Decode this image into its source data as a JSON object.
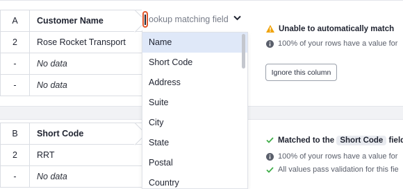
{
  "columns": [
    {
      "letter": "A",
      "name": "Customer Name",
      "rows": [
        {
          "num": "2",
          "value": "Rose Rocket Transport",
          "empty": false
        },
        {
          "num": "-",
          "value": "No data",
          "empty": true
        },
        {
          "num": "-",
          "value": "No data",
          "empty": true
        }
      ],
      "status": {
        "title": "Unable to automatically match",
        "info": "100% of your rows have a value for",
        "ignore_button": "Ignore this column"
      }
    },
    {
      "letter": "B",
      "name": "Short Code",
      "rows": [
        {
          "num": "2",
          "value": "RRT",
          "empty": false
        },
        {
          "num": "-",
          "value": "No data",
          "empty": true
        }
      ],
      "status": {
        "title_prefix": "Matched to the",
        "match_field": "Short Code",
        "title_suffix": "field.",
        "info": "100% of your rows have a value for",
        "validation": "All values pass validation for this fie"
      }
    }
  ],
  "lookup": {
    "placeholder": "ookup matching field",
    "options": [
      "Name",
      "Short Code",
      "Address",
      "Suite",
      "City",
      "State",
      "Postal",
      "Country"
    ],
    "selected_index": 0
  },
  "colors": {
    "warning": "#f0a30a",
    "success": "#3fae49",
    "info": "#5a5f6b",
    "cursor_highlight": "#e2572c",
    "selected_option": "#dfe8f8"
  }
}
